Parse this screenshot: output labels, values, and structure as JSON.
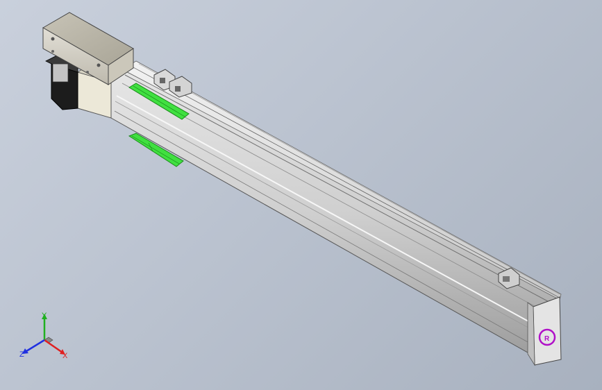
{
  "viewport": {
    "background_top": "#c9d0dc",
    "background_bottom": "#a8b1bf"
  },
  "model": {
    "rail_color": "#dcdcdc",
    "rail_shadow": "#9a9a9a",
    "motor_color": "#1c1c1c",
    "housing_color": "#d2cfc6",
    "highlight_color": "#40e040",
    "logo_color": "#b010c8"
  },
  "triad": {
    "x_label": "X",
    "y_label": "Y",
    "z_label": "Z",
    "x_color": "#e02020",
    "y_color": "#20b020",
    "z_color": "#2030e0"
  }
}
